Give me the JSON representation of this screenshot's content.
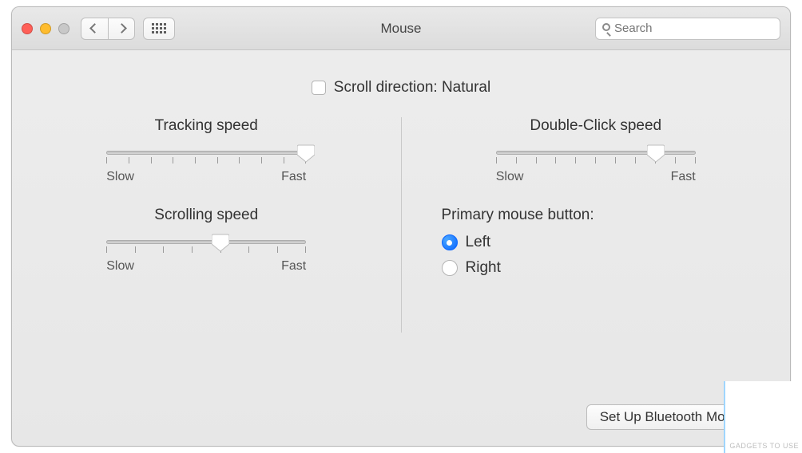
{
  "window": {
    "title": "Mouse"
  },
  "search": {
    "placeholder": "Search",
    "value": ""
  },
  "scrollNatural": {
    "label": "Scroll direction: Natural",
    "checked": false
  },
  "tracking": {
    "title": "Tracking speed",
    "slow": "Slow",
    "fast": "Fast",
    "value": 9,
    "max": 9
  },
  "scrolling": {
    "title": "Scrolling speed",
    "slow": "Slow",
    "fast": "Fast",
    "value": 4,
    "max": 7
  },
  "doubleClick": {
    "title": "Double-Click speed",
    "slow": "Slow",
    "fast": "Fast",
    "value": 8,
    "max": 10
  },
  "primary": {
    "title": "Primary mouse button:",
    "left": "Left",
    "right": "Right",
    "selected": "left"
  },
  "setupButton": "Set Up Bluetooth Mouse…",
  "watermark": "GADGETS TO USE"
}
